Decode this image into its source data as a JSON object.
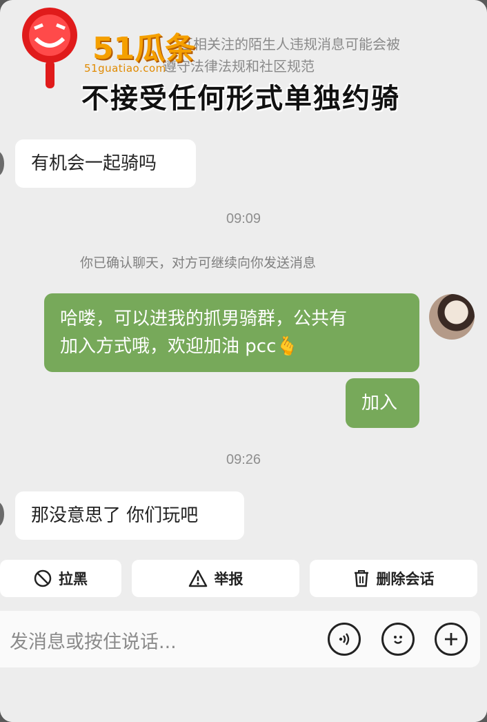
{
  "notice": {
    "line1": "互相关注的陌生人违规消息可能会被",
    "line2": "遵守法律法规和社区规范"
  },
  "overlay_caption": "不接受任何形式单独约骑",
  "watermark": {
    "brand": "51瓜条",
    "url": "51guatiao.com"
  },
  "messages": [
    {
      "side": "in",
      "text": "有机会一起骑吗"
    },
    {
      "type": "time",
      "text": "09:09"
    },
    {
      "type": "system",
      "text": "你已确认聊天，对方可继续向你发送消息"
    },
    {
      "side": "out",
      "lines": [
        "哈喽，可以进我的抓男骑群，公共有",
        "加入方式哦，欢迎加油 pcc🫰"
      ]
    },
    {
      "side": "out",
      "text": "加入"
    },
    {
      "type": "time",
      "text": "09:26"
    },
    {
      "side": "in",
      "text": "那没意思了 你们玩吧"
    }
  ],
  "actions": {
    "block": {
      "label": "拉黑",
      "icon": "block-icon"
    },
    "report": {
      "label": "举报",
      "icon": "warning-icon"
    },
    "delete": {
      "label": "删除会话",
      "icon": "trash-icon"
    }
  },
  "input": {
    "placeholder": "发消息或按住说话...",
    "icons": [
      "voice-icon",
      "emoji-icon",
      "plus-icon"
    ]
  },
  "colors": {
    "outgoing_bubble": "#77a95a",
    "incoming_bubble": "#ffffff",
    "background": "#ededed",
    "watermark": "#f5a000"
  }
}
